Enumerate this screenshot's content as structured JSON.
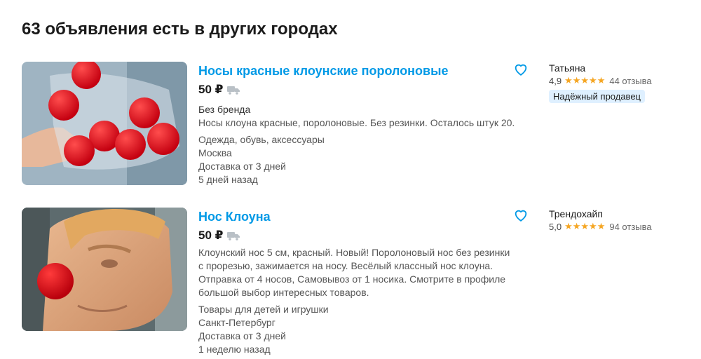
{
  "heading": "63 объявления есть в других городах",
  "listings": [
    {
      "title": "Носы красные клоунские поролоновые",
      "price": "50 ₽",
      "lines_a": [
        "Без бренда",
        "Носы клоуна красные, поролоновые. Без резинки. Осталось штук 20."
      ],
      "lines_b": [
        "Одежда, обувь, аксессуары",
        "Москва",
        "Доставка от 3 дней",
        "5 дней назад"
      ],
      "seller": {
        "name": "Татьяна",
        "rating": "4,9",
        "stars": "★★★★★",
        "reviews": "44 отзыва",
        "badge": "Надёжный продавец"
      }
    },
    {
      "title": "Нос Клоуна",
      "price": "50 ₽",
      "lines_a": [
        "Клоунский нос 5 см, красный. Новый! Поролоновый нос без резинки",
        "с прорезью, зажимается на носу. Весёлый классный нос клоуна.",
        "Отправка от 4 носов, Самовывоз от 1 носика. Смотрите в профиле",
        "большой выбор интересных товаров."
      ],
      "lines_b": [
        "Товары для детей и игрушки",
        "Санкт-Петербург",
        "Доставка от 3 дней",
        "1 неделю назад"
      ],
      "seller": {
        "name": "Трендохайп",
        "rating": "5,0",
        "stars": "★★★★★",
        "reviews": "94 отзыва"
      }
    }
  ],
  "colors": {
    "title_link": "#0099e6",
    "star": "#f5a623",
    "badge_bg": "#dff0ff"
  }
}
